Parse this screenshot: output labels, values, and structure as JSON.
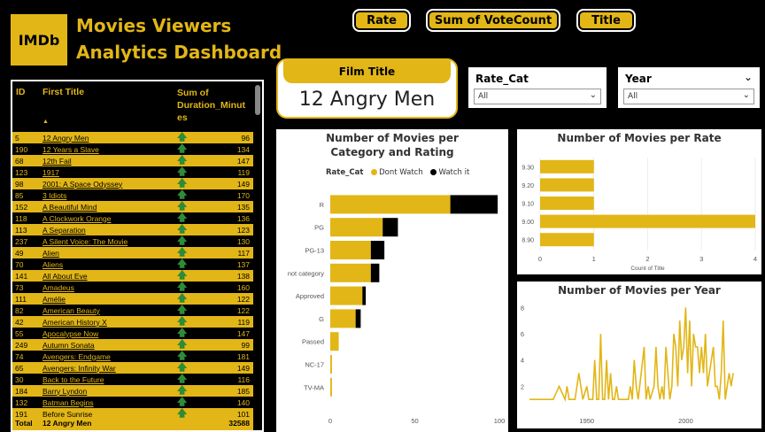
{
  "header": {
    "logo_text": "IMDb",
    "title_line1": "Movies Viewers",
    "title_line2": "Analytics Dashboard",
    "buttons": [
      "Rate",
      "Sum of VoteCount",
      "Title"
    ]
  },
  "table": {
    "columns": [
      "ID",
      "First Title",
      "Sum of",
      "Duration_Minut",
      "es"
    ],
    "rows": [
      {
        "id": "5",
        "title": "12 Angry Men",
        "dur": "96"
      },
      {
        "id": "190",
        "title": "12 Years a Slave",
        "dur": "134"
      },
      {
        "id": "68",
        "title": "12th Fail",
        "dur": "147"
      },
      {
        "id": "123",
        "title": "1917",
        "dur": "119"
      },
      {
        "id": "98",
        "title": "2001: A Space Odyssey",
        "dur": "149"
      },
      {
        "id": "85",
        "title": "3 Idiots",
        "dur": "170"
      },
      {
        "id": "152",
        "title": "A Beautiful Mind",
        "dur": "135"
      },
      {
        "id": "118",
        "title": "A Clockwork Orange",
        "dur": "136"
      },
      {
        "id": "113",
        "title": "A Separation",
        "dur": "123"
      },
      {
        "id": "237",
        "title": "A Silent Voice: The Movie",
        "dur": "130"
      },
      {
        "id": "49",
        "title": "Alien",
        "dur": "117"
      },
      {
        "id": "70",
        "title": "Aliens",
        "dur": "137"
      },
      {
        "id": "141",
        "title": "All About Eve",
        "dur": "138"
      },
      {
        "id": "73",
        "title": "Amadeus",
        "dur": "160"
      },
      {
        "id": "111",
        "title": "Amélie",
        "dur": "122"
      },
      {
        "id": "82",
        "title": "American Beauty",
        "dur": "122"
      },
      {
        "id": "42",
        "title": "American History X",
        "dur": "119"
      },
      {
        "id": "55",
        "title": "Apocalypse Now",
        "dur": "147"
      },
      {
        "id": "249",
        "title": "Autumn Sonata",
        "dur": "99"
      },
      {
        "id": "74",
        "title": "Avengers: Endgame",
        "dur": "181"
      },
      {
        "id": "65",
        "title": "Avengers: Infinity War",
        "dur": "149"
      },
      {
        "id": "30",
        "title": "Back to the Future",
        "dur": "116"
      },
      {
        "id": "184",
        "title": "Barry Lyndon",
        "dur": "185"
      },
      {
        "id": "132",
        "title": "Batman Begins",
        "dur": "140"
      },
      {
        "id": "191",
        "title": "Before Sunrise",
        "dur": "101"
      }
    ],
    "total": {
      "label": "Total",
      "title": "12 Angry Men",
      "dur": "32588"
    }
  },
  "card": {
    "label": "Film Title",
    "value": "12 Angry Men"
  },
  "slicers": [
    {
      "label": "Rate_Cat",
      "value": "All"
    },
    {
      "label": "Year",
      "value": "All"
    }
  ],
  "colors": {
    "gold": "#e2b616",
    "black": "#000000",
    "white": "#ffffff",
    "green": "#2e8b3a"
  },
  "chart_data": [
    {
      "type": "bar",
      "orientation": "horizontal",
      "stacked": true,
      "title": "Number of Movies per Category and Rating",
      "legend_title": "Rate_Cat",
      "legend_position": "top-left",
      "categories": [
        "R",
        "PG",
        "PG-13",
        "not category",
        "Approved",
        "G",
        "Passed",
        "NC-17",
        "TV-MA"
      ],
      "series": [
        {
          "name": "Dont Watch",
          "color": "#e2b616",
          "values": [
            71,
            31,
            24,
            24,
            19,
            15,
            5,
            1,
            1
          ]
        },
        {
          "name": "Watch it",
          "color": "#000000",
          "values": [
            28,
            9,
            8,
            5,
            2,
            3,
            0,
            0,
            0
          ]
        }
      ],
      "xticks": [
        "0",
        "50",
        "100"
      ],
      "xlim": [
        0,
        100
      ]
    },
    {
      "type": "bar",
      "orientation": "horizontal",
      "title": "Number of Movies per Rate",
      "xlabel": "Count of Title",
      "categories": [
        "9.30",
        "9.20",
        "9.10",
        "9.00",
        "8.90"
      ],
      "values": [
        1,
        1,
        1,
        4,
        1
      ],
      "xticks": [
        "0",
        "1",
        "2",
        "3",
        "4"
      ],
      "xlim": [
        0,
        4
      ]
    },
    {
      "type": "line",
      "title": "Number of Movies per Year",
      "x": [
        1921,
        1925,
        1926,
        1927,
        1928,
        1931,
        1933,
        1936,
        1939,
        1940,
        1941,
        1942,
        1944,
        1946,
        1948,
        1950,
        1951,
        1952,
        1953,
        1954,
        1955,
        1956,
        1957,
        1958,
        1959,
        1960,
        1961,
        1962,
        1963,
        1964,
        1965,
        1966,
        1968,
        1971,
        1972,
        1973,
        1974,
        1975,
        1976,
        1979,
        1980,
        1981,
        1982,
        1984,
        1985,
        1986,
        1987,
        1988,
        1989,
        1990,
        1991,
        1992,
        1993,
        1994,
        1995,
        1996,
        1997,
        1998,
        1999,
        2000,
        2001,
        2002,
        2003,
        2004,
        2005,
        2006,
        2007,
        2008,
        2009,
        2010,
        2011,
        2012,
        2013,
        2014,
        2015,
        2016,
        2017,
        2018,
        2019,
        2020,
        2021,
        2022,
        2023,
        2024
      ],
      "y": [
        1,
        1,
        1,
        1,
        1,
        1,
        1,
        2,
        1,
        2,
        1,
        1,
        1,
        3,
        1,
        2,
        1,
        1,
        1,
        4,
        1,
        1,
        6,
        1,
        1,
        4,
        1,
        3,
        1,
        1,
        2,
        1,
        1,
        1,
        2,
        1,
        4,
        2,
        1,
        5,
        1,
        2,
        1,
        2,
        5,
        2,
        1,
        2,
        1,
        5,
        3,
        1,
        2,
        6,
        5,
        2,
        7,
        4,
        5,
        8,
        3,
        7,
        2,
        6,
        5,
        5,
        3,
        5,
        3,
        6,
        2,
        3,
        4,
        5,
        2,
        2,
        1,
        3,
        7,
        1,
        2,
        3,
        2,
        3
      ],
      "xticks": [
        "1950",
        "2000"
      ],
      "yticks": [
        "2",
        "4",
        "6",
        "8"
      ],
      "ylim": [
        0,
        8.5
      ]
    }
  ]
}
